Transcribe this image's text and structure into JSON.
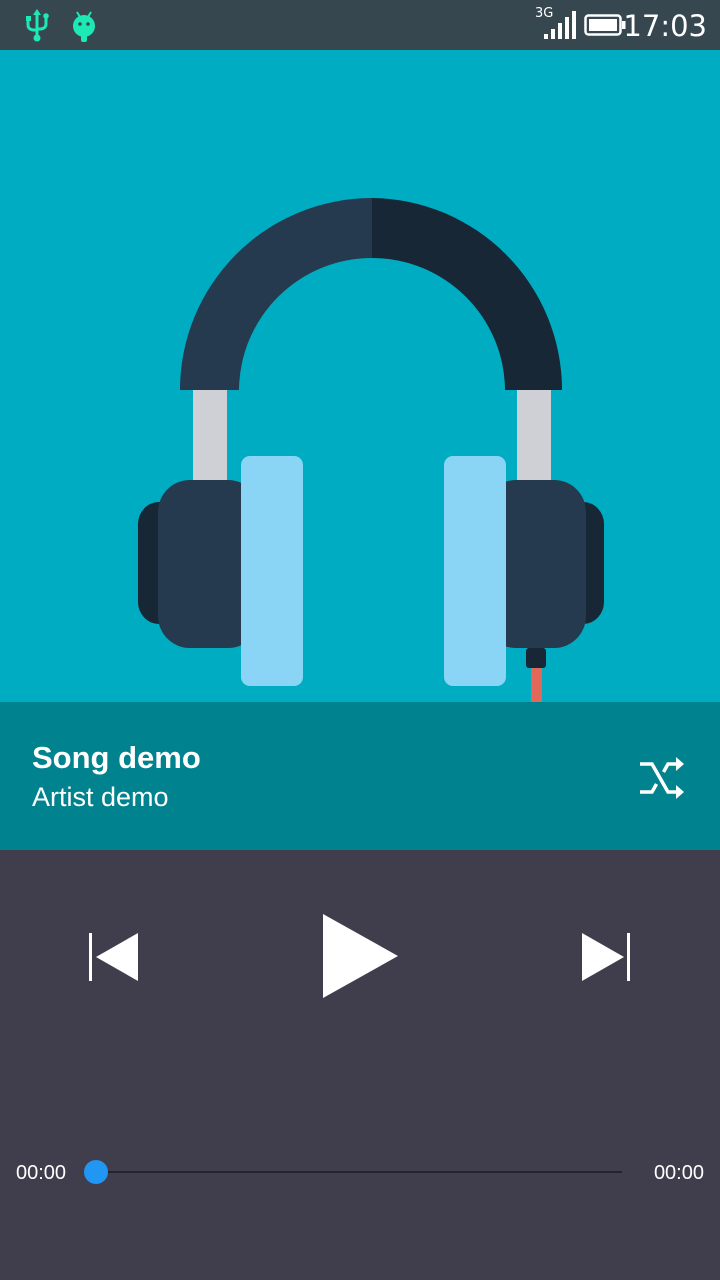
{
  "status_bar": {
    "network_type": "3G",
    "time": "17:03",
    "icons": [
      "usb-icon",
      "android-debug-icon",
      "signal-icon",
      "battery-icon"
    ]
  },
  "track": {
    "title": "Song demo",
    "artist": "Artist demo"
  },
  "player": {
    "current_time": "00:00",
    "total_time": "00:00",
    "progress": 0,
    "buttons": [
      "shuffle-icon",
      "skip-previous-icon",
      "play-icon",
      "skip-next-icon"
    ]
  },
  "colors": {
    "status_bar": "#37474f",
    "album_background": "#00acc1",
    "info_panel": "#00838f",
    "controls_background": "#403e4c",
    "accent": "#2196f3"
  }
}
